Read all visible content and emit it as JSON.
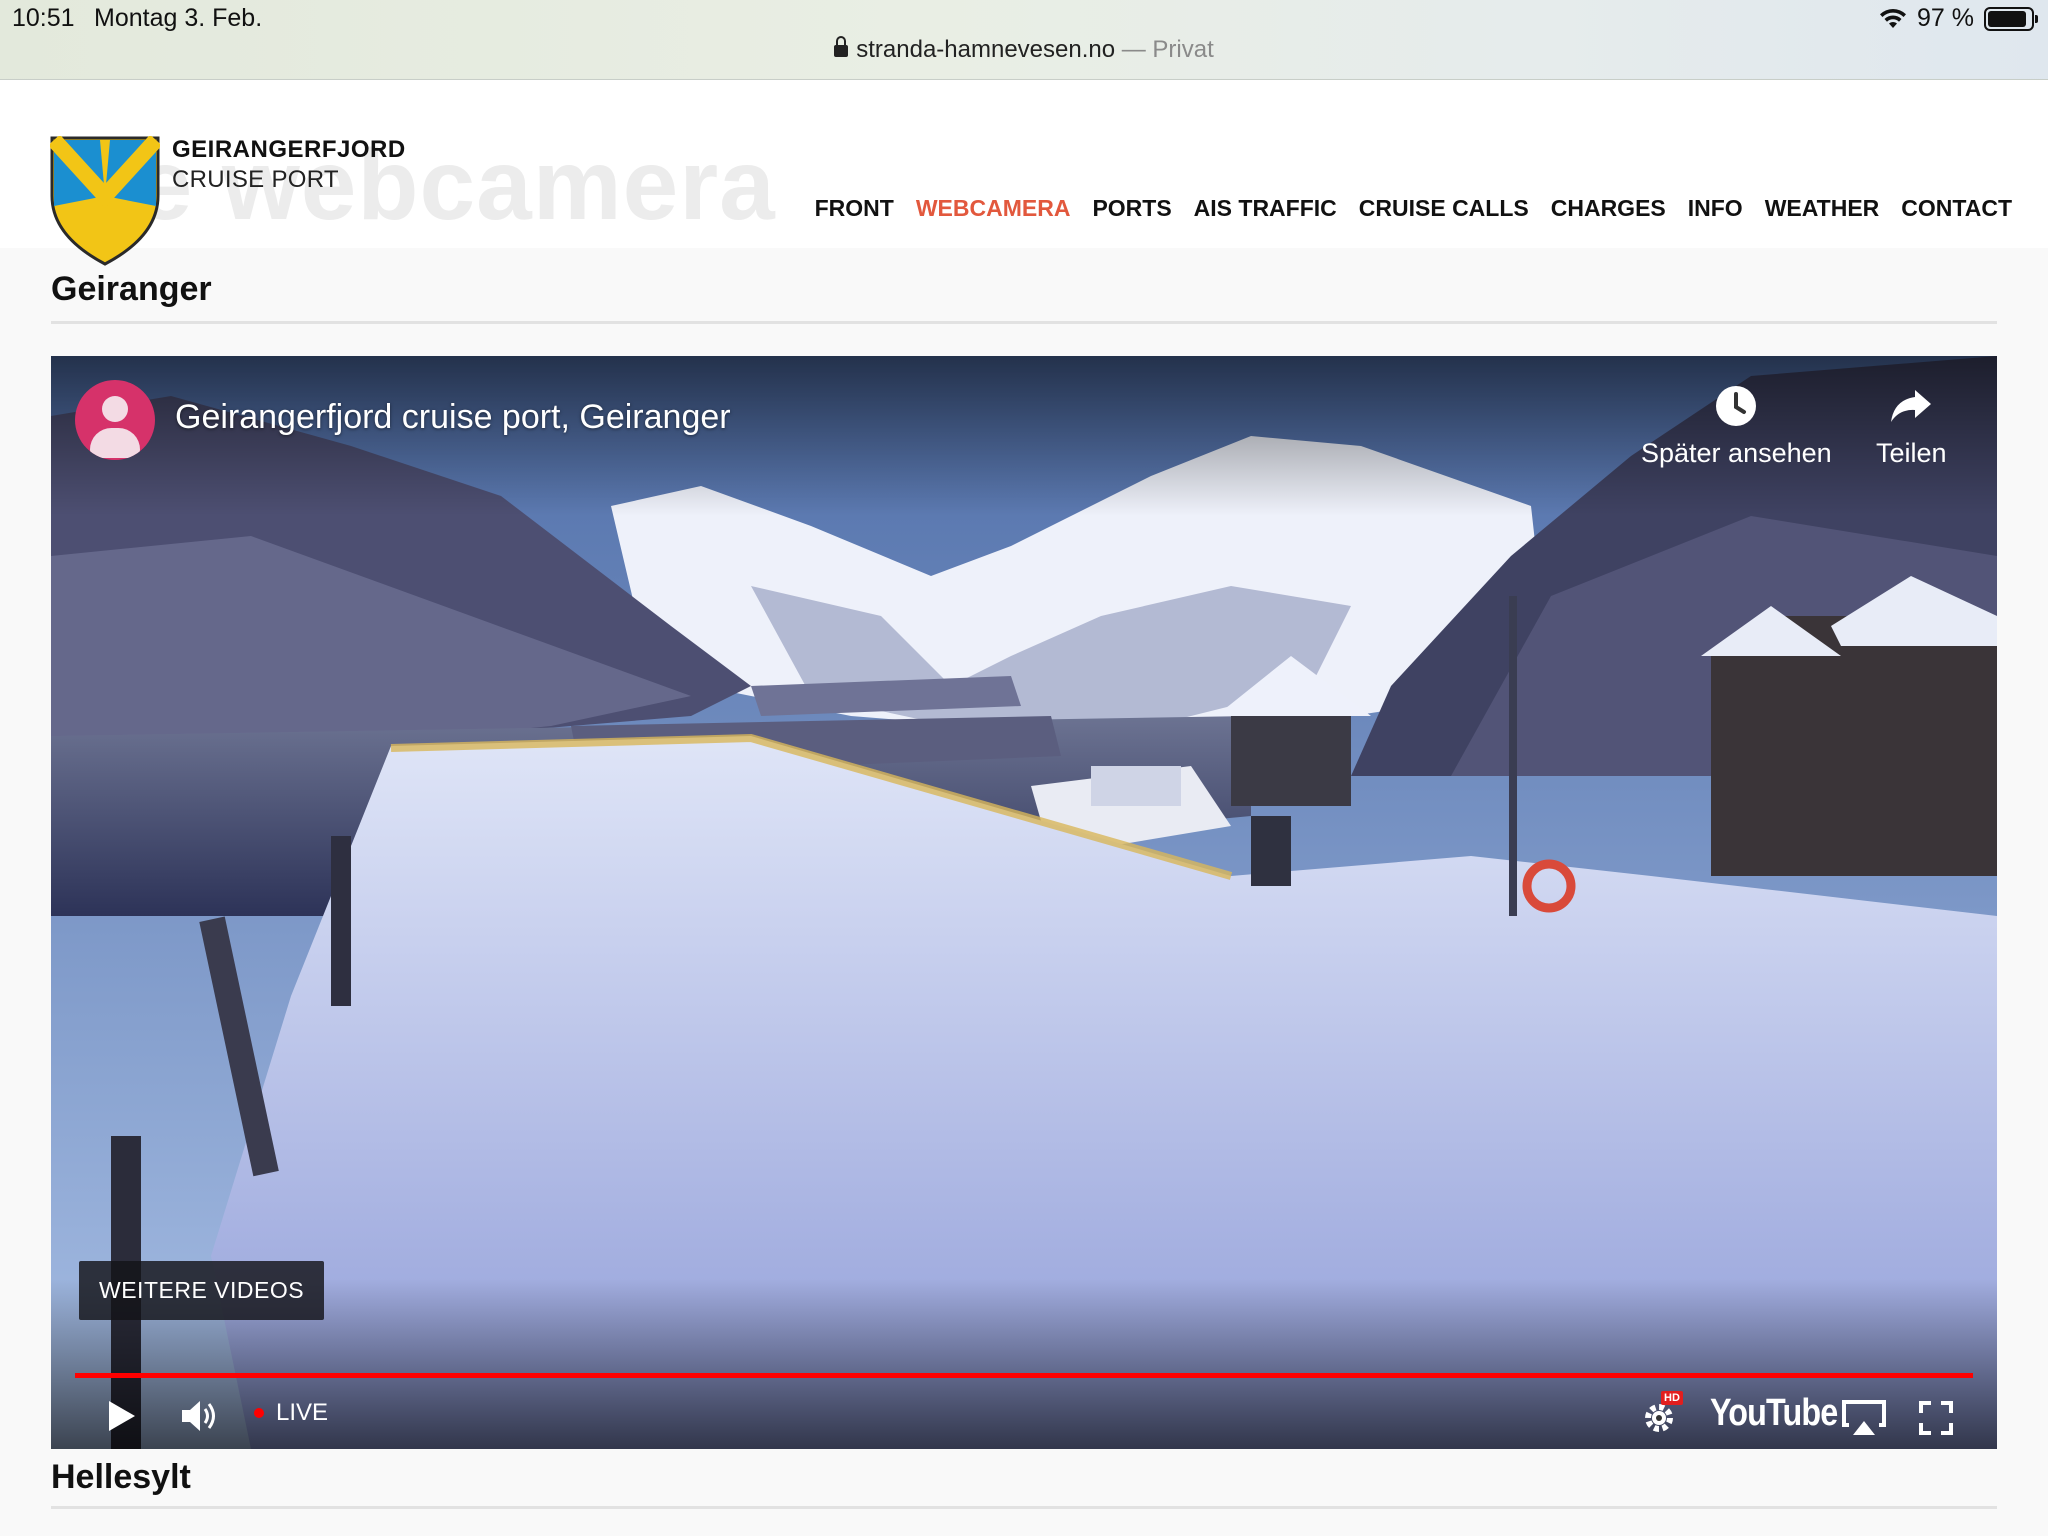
{
  "status_bar": {
    "time": "10:51",
    "date": "Montag 3. Feb.",
    "battery": "97 %"
  },
  "browser": {
    "domain": "stranda-hamnevesen.no",
    "mode": "— Privat"
  },
  "site": {
    "logo_name": "GEIRANGERFJORD",
    "logo_sub": "CRUISE PORT",
    "ghost_heading": "ve webcamera",
    "nav": [
      {
        "label": "FRONT",
        "active": false
      },
      {
        "label": "WEBCAMERA",
        "active": true
      },
      {
        "label": "PORTS",
        "active": false
      },
      {
        "label": "AIS TRAFFIC",
        "active": false
      },
      {
        "label": "CRUISE CALLS",
        "active": false
      },
      {
        "label": "CHARGES",
        "active": false
      },
      {
        "label": "INFO",
        "active": false
      },
      {
        "label": "WEATHER",
        "active": false
      },
      {
        "label": "CONTACT",
        "active": false
      }
    ],
    "accent": "#e2583d"
  },
  "sections": {
    "first": "Geiranger",
    "second": "Hellesylt"
  },
  "player": {
    "title": "Geirangerfjord cruise port, Geiranger",
    "watch_later": "Später ansehen",
    "share": "Teilen",
    "more_videos": "WEITERE VIDEOS",
    "live_label": "LIVE",
    "youtube_label": "YouTube",
    "hd_badge": "HD",
    "progress_fraction": 1.0,
    "progress_color": "#ff0000",
    "icons": [
      "clock-icon",
      "share-arrow-icon",
      "play-icon",
      "volume-icon",
      "settings-gear-icon",
      "airplay-icon",
      "fullscreen-icon"
    ]
  }
}
